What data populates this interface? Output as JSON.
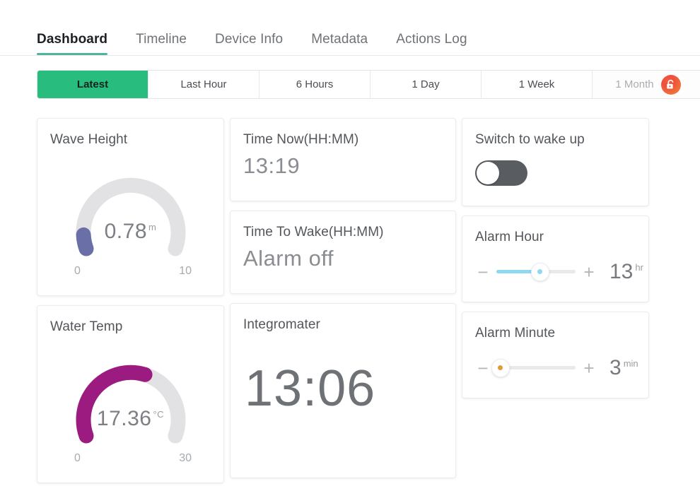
{
  "nav": {
    "tabs": [
      {
        "label": "Dashboard",
        "active": true
      },
      {
        "label": "Timeline",
        "active": false
      },
      {
        "label": "Device Info",
        "active": false
      },
      {
        "label": "Metadata",
        "active": false
      },
      {
        "label": "Actions Log",
        "active": false
      }
    ]
  },
  "ranges": {
    "items": [
      {
        "label": "Latest",
        "state": "active"
      },
      {
        "label": "Last Hour",
        "state": "normal"
      },
      {
        "label": "6 Hours",
        "state": "normal"
      },
      {
        "label": "1 Day",
        "state": "normal"
      },
      {
        "label": "1 Week",
        "state": "normal"
      },
      {
        "label": "1 Month",
        "state": "locked",
        "icon": "unlock-icon"
      }
    ],
    "active_color": "#29bc7f",
    "lock_color": "#ef5a3a"
  },
  "cards": {
    "wave_height": {
      "title": "Wave Height",
      "value": "0.78",
      "unit": "m",
      "min": "0",
      "max": "10",
      "percent": 7.8,
      "arc_color": "#6b6fa8",
      "track_color": "#e2e2e4"
    },
    "water_temp": {
      "title": "Water Temp",
      "value": "17.36",
      "unit": "°C",
      "min": "0",
      "max": "30",
      "percent": 57.9,
      "arc_color": "#9c1b80",
      "track_color": "#e2e2e4"
    },
    "time_now": {
      "title": "Time Now(HH:MM)",
      "value": "13:19"
    },
    "time_to_wake": {
      "title": "Time To Wake(HH:MM)",
      "value": "Alarm off"
    },
    "integromater": {
      "title": "Integromater",
      "value": "13:06"
    },
    "switch_wake": {
      "title": "Switch to wake up",
      "state": "off",
      "track_color": "#595d62"
    },
    "alarm_hour": {
      "title": "Alarm Hour",
      "minus_label": "−",
      "plus_label": "+",
      "value": "13",
      "unit": "hr",
      "percent": 55,
      "fill_color": "#8ed8f2",
      "dot_color": "#8ed8f2"
    },
    "alarm_minute": {
      "title": "Alarm Minute",
      "minus_label": "−",
      "plus_label": "+",
      "value": "3",
      "unit": "min",
      "percent": 5,
      "fill_color": "#f0f1f3",
      "dot_color": "#e09b3d"
    }
  }
}
